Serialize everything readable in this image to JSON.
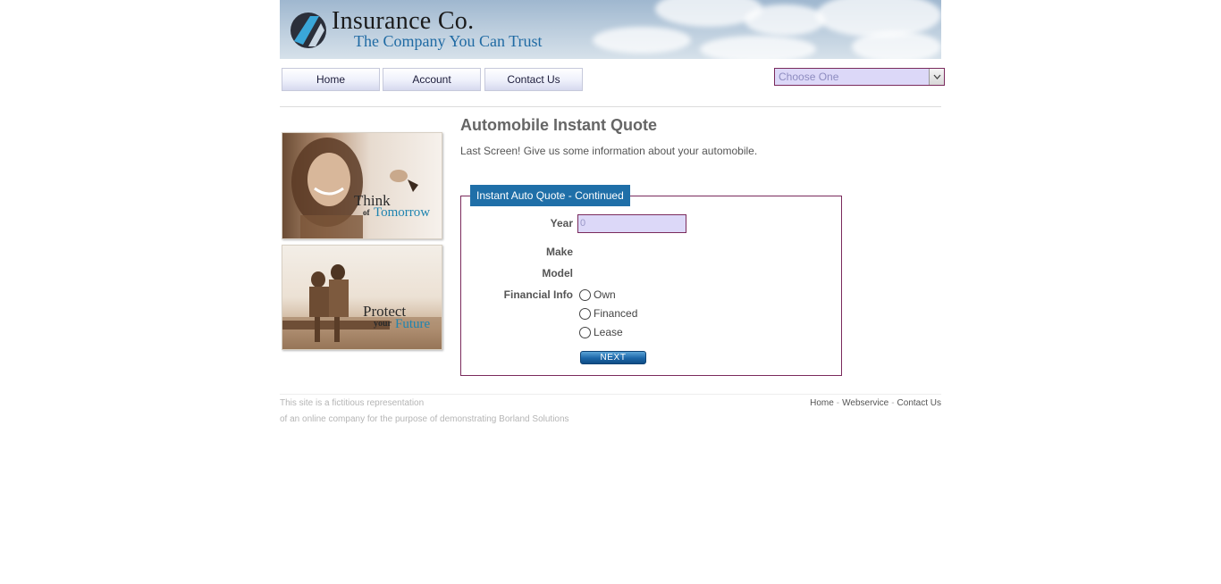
{
  "header": {
    "brand_name": "Insurance Co.",
    "tagline": "The Company You Can Trust"
  },
  "nav": {
    "items": [
      "Home",
      "Account",
      "Contact Us"
    ],
    "select_value": "Choose One"
  },
  "side": {
    "promo1": {
      "line1": "Think",
      "line2": "of",
      "line3": "Tomorrow"
    },
    "promo2": {
      "line1": "Protect",
      "line2": "your",
      "line3": "Future"
    }
  },
  "main": {
    "title": "Automobile Instant Quote",
    "subtitle": "Last Screen! Give us some information about your automobile.",
    "form": {
      "legend": "Instant Auto Quote - Continued",
      "year_label": "Year",
      "year_value": "0",
      "make_label": "Make",
      "model_label": "Model",
      "financial_label": "Financial Info",
      "options": [
        "Own",
        "Financed",
        "Lease"
      ],
      "next_label": "NEXT"
    }
  },
  "footer": {
    "line1": "This site is a fictitious representation",
    "line2": "of an online company for the purpose of demonstrating Borland Solutions",
    "links": [
      "Home",
      "Webservice",
      "Contact Us"
    ]
  },
  "colors": {
    "accent": "#1f6fa8",
    "form_border": "#7a2a5c",
    "input_bg": "#dcd8f8"
  }
}
